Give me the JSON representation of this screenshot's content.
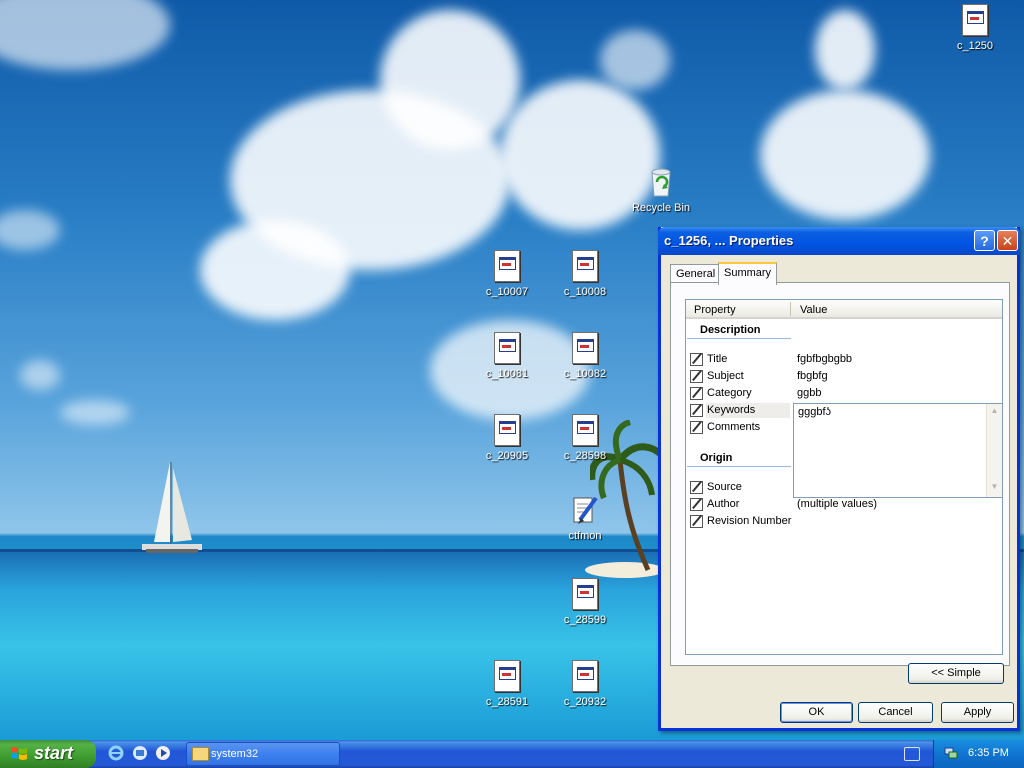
{
  "desktop": {
    "icons": [
      {
        "id": "c1250",
        "label": "c_1250",
        "kind": "doc"
      },
      {
        "id": "recycle",
        "label": "Recycle Bin",
        "kind": "recycle"
      },
      {
        "id": "c10007",
        "label": "c_10007",
        "kind": "doc"
      },
      {
        "id": "c10008",
        "label": "c_10008",
        "kind": "doc"
      },
      {
        "id": "c10081",
        "label": "c_10081",
        "kind": "doc"
      },
      {
        "id": "c10082",
        "label": "c_10082",
        "kind": "doc"
      },
      {
        "id": "c20905",
        "label": "c_20905",
        "kind": "doc"
      },
      {
        "id": "c28598",
        "label": "c_28598",
        "kind": "doc"
      },
      {
        "id": "ctfmon",
        "label": "ctfmon",
        "kind": "app"
      },
      {
        "id": "c28599",
        "label": "c_28599",
        "kind": "doc"
      },
      {
        "id": "c28591",
        "label": "c_28591",
        "kind": "doc"
      },
      {
        "id": "c20932",
        "label": "c_20932",
        "kind": "doc"
      }
    ]
  },
  "dialog": {
    "title": "c_1256, ... Properties",
    "help_icon": "question-mark-icon",
    "close_icon": "close-icon",
    "tabs": [
      {
        "label": "General",
        "active": false
      },
      {
        "label": "Summary",
        "active": true
      }
    ],
    "grid": {
      "col_property": "Property",
      "col_value": "Value",
      "description_section": "Description",
      "origin_section": "Origin",
      "rows": [
        {
          "property": "Title",
          "value": "fgbfbgbgbb"
        },
        {
          "property": "Subject",
          "value": "fbgbfg"
        },
        {
          "property": "Category",
          "value": "ggbb"
        },
        {
          "property": "Keywords",
          "value": "gggbfʖ"
        },
        {
          "property": "Comments",
          "value": ""
        },
        {
          "property": "Source",
          "value": ""
        },
        {
          "property": "Author",
          "value": "(multiple values)"
        },
        {
          "property": "Revision Number",
          "value": ""
        }
      ]
    },
    "simple_button": "<< Simple",
    "ok_button": "OK",
    "cancel_button": "Cancel",
    "apply_button": "Apply"
  },
  "taskbar": {
    "start_label": "start",
    "task_button": "system32",
    "clock": "6:35 PM"
  },
  "colors": {
    "title_bar": "#0054e3",
    "start_green": "#3e9c30",
    "taskbar_blue": "#2458d5",
    "tab_highlight": "#ffc83c"
  }
}
